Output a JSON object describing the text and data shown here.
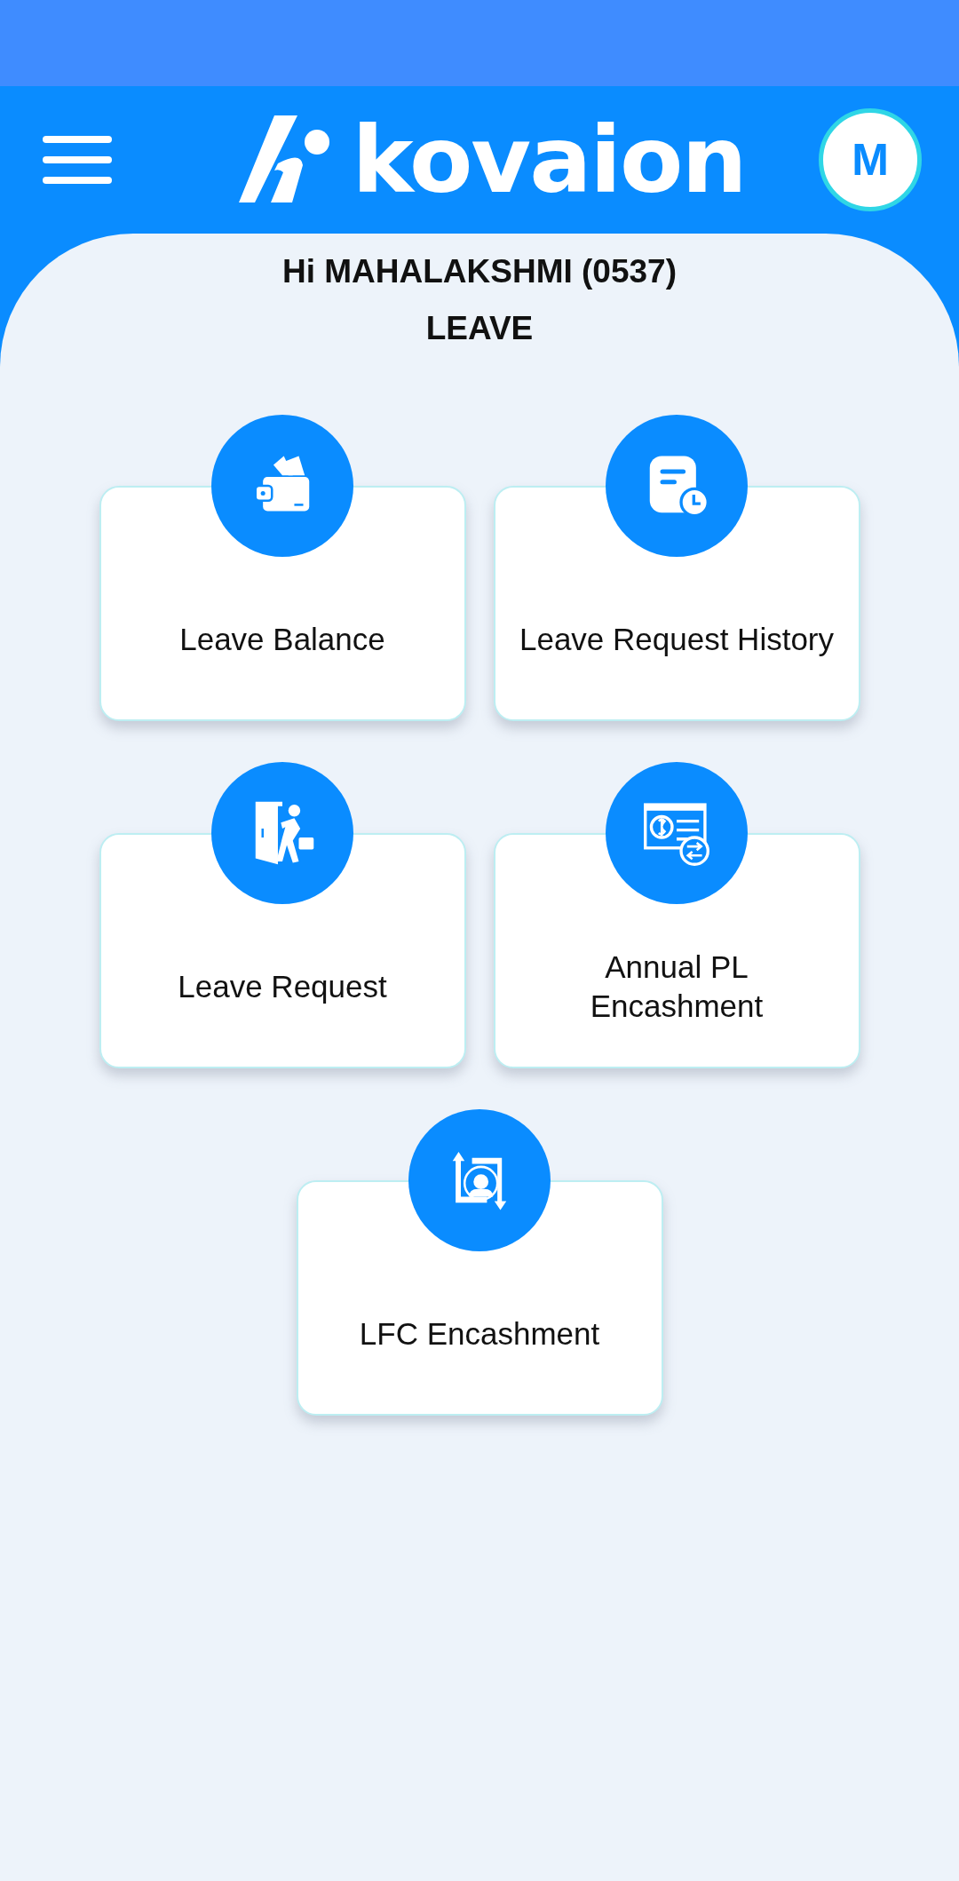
{
  "header": {
    "logo": "kovaion",
    "avatar": "M"
  },
  "greeting": "Hi MAHALAKSHMI (0537)",
  "section_title": "LEAVE",
  "tiles": [
    {
      "label": "Leave Balance",
      "kind": "wallet"
    },
    {
      "label": "Leave Request History",
      "kind": "history"
    },
    {
      "label": "Leave Request",
      "kind": "exit"
    },
    {
      "label": "Annual PL\nEncashment",
      "kind": "payment"
    },
    {
      "label": "LFC Encashment",
      "kind": "transfer"
    }
  ]
}
